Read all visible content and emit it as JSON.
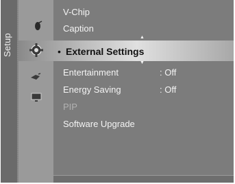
{
  "side_tab": {
    "label": "Setup"
  },
  "menu": {
    "items": [
      {
        "label": "V-Chip",
        "value": ""
      },
      {
        "label": "Caption",
        "value": ""
      },
      {
        "label": "External Settings",
        "value": "",
        "selected": true
      },
      {
        "label": "Entertainment",
        "value": ": Off"
      },
      {
        "label": "Energy Saving",
        "value": ": Off"
      },
      {
        "label": "PIP",
        "value": "",
        "disabled": true
      },
      {
        "label": "Software Upgrade",
        "value": ""
      }
    ],
    "selected_bullet": "•",
    "scroll_up": "▲",
    "scroll_down": "▼"
  },
  "icons": {
    "channel": "satellite-dish-icon",
    "setup": "gear-icon",
    "input": "input-plug-icon",
    "support": "support-monitor-icon"
  },
  "colors": {
    "panel": "#858585",
    "side_tab": "#6a6a6a",
    "icon_column": "#9a9a9a",
    "content": "#7c7c7c",
    "highlight": "#e0e0e0",
    "text": "#f4f4f4",
    "selected_text": "#111111",
    "disabled_text": "#b2b2b2"
  }
}
